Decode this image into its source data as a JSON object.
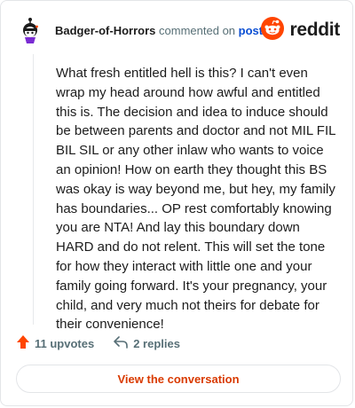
{
  "header": {
    "username": "Badger-of-Horrors",
    "verb": "commented on",
    "link_text": "post",
    "brand_text": "reddit",
    "avatar_icon": "snoo-avatar-icon",
    "brand_icon": "reddit-logo-icon"
  },
  "comment": {
    "body": "What fresh entitled hell is this? I can't even wrap my head around how awful and entitled this is. The decision and idea to induce should be between parents and doctor and not MIL FIL BIL SIL or any other inlaw who wants to voice an opinion! How on earth they thought this BS was okay is way beyond me, but hey, my family has boundaries... OP rest comfortably knowing you are NTA! And lay this boundary down HARD and do not relent. This will set the tone for how they interact with little one and your family going forward. It's your pregnancy, your child, and very much not theirs for debate for their convenience!"
  },
  "actions": {
    "upvotes": "11 upvotes",
    "replies": "2 replies",
    "upvote_icon": "upvote-arrow-icon",
    "reply_icon": "reply-arrow-icon"
  },
  "cta": {
    "label": "View the conversation"
  },
  "colors": {
    "brand": "#ff4500",
    "link": "#0a4ed3",
    "cta": "#d93a00",
    "muted": "#576f76"
  }
}
